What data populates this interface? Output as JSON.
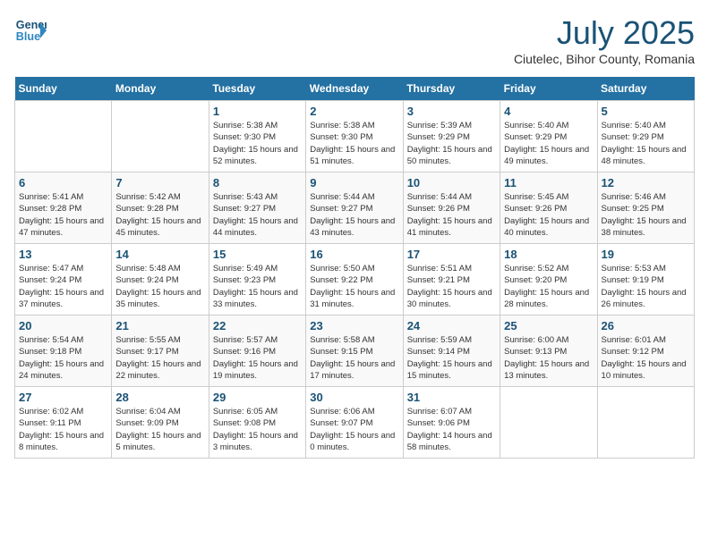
{
  "header": {
    "logo_line1": "General",
    "logo_line2": "Blue",
    "month": "July 2025",
    "location": "Ciutelec, Bihor County, Romania"
  },
  "weekdays": [
    "Sunday",
    "Monday",
    "Tuesday",
    "Wednesday",
    "Thursday",
    "Friday",
    "Saturday"
  ],
  "weeks": [
    [
      {
        "day": "",
        "sunrise": "",
        "sunset": "",
        "daylight": ""
      },
      {
        "day": "",
        "sunrise": "",
        "sunset": "",
        "daylight": ""
      },
      {
        "day": "1",
        "sunrise": "Sunrise: 5:38 AM",
        "sunset": "Sunset: 9:30 PM",
        "daylight": "Daylight: 15 hours and 52 minutes."
      },
      {
        "day": "2",
        "sunrise": "Sunrise: 5:38 AM",
        "sunset": "Sunset: 9:30 PM",
        "daylight": "Daylight: 15 hours and 51 minutes."
      },
      {
        "day": "3",
        "sunrise": "Sunrise: 5:39 AM",
        "sunset": "Sunset: 9:29 PM",
        "daylight": "Daylight: 15 hours and 50 minutes."
      },
      {
        "day": "4",
        "sunrise": "Sunrise: 5:40 AM",
        "sunset": "Sunset: 9:29 PM",
        "daylight": "Daylight: 15 hours and 49 minutes."
      },
      {
        "day": "5",
        "sunrise": "Sunrise: 5:40 AM",
        "sunset": "Sunset: 9:29 PM",
        "daylight": "Daylight: 15 hours and 48 minutes."
      }
    ],
    [
      {
        "day": "6",
        "sunrise": "Sunrise: 5:41 AM",
        "sunset": "Sunset: 9:28 PM",
        "daylight": "Daylight: 15 hours and 47 minutes."
      },
      {
        "day": "7",
        "sunrise": "Sunrise: 5:42 AM",
        "sunset": "Sunset: 9:28 PM",
        "daylight": "Daylight: 15 hours and 45 minutes."
      },
      {
        "day": "8",
        "sunrise": "Sunrise: 5:43 AM",
        "sunset": "Sunset: 9:27 PM",
        "daylight": "Daylight: 15 hours and 44 minutes."
      },
      {
        "day": "9",
        "sunrise": "Sunrise: 5:44 AM",
        "sunset": "Sunset: 9:27 PM",
        "daylight": "Daylight: 15 hours and 43 minutes."
      },
      {
        "day": "10",
        "sunrise": "Sunrise: 5:44 AM",
        "sunset": "Sunset: 9:26 PM",
        "daylight": "Daylight: 15 hours and 41 minutes."
      },
      {
        "day": "11",
        "sunrise": "Sunrise: 5:45 AM",
        "sunset": "Sunset: 9:26 PM",
        "daylight": "Daylight: 15 hours and 40 minutes."
      },
      {
        "day": "12",
        "sunrise": "Sunrise: 5:46 AM",
        "sunset": "Sunset: 9:25 PM",
        "daylight": "Daylight: 15 hours and 38 minutes."
      }
    ],
    [
      {
        "day": "13",
        "sunrise": "Sunrise: 5:47 AM",
        "sunset": "Sunset: 9:24 PM",
        "daylight": "Daylight: 15 hours and 37 minutes."
      },
      {
        "day": "14",
        "sunrise": "Sunrise: 5:48 AM",
        "sunset": "Sunset: 9:24 PM",
        "daylight": "Daylight: 15 hours and 35 minutes."
      },
      {
        "day": "15",
        "sunrise": "Sunrise: 5:49 AM",
        "sunset": "Sunset: 9:23 PM",
        "daylight": "Daylight: 15 hours and 33 minutes."
      },
      {
        "day": "16",
        "sunrise": "Sunrise: 5:50 AM",
        "sunset": "Sunset: 9:22 PM",
        "daylight": "Daylight: 15 hours and 31 minutes."
      },
      {
        "day": "17",
        "sunrise": "Sunrise: 5:51 AM",
        "sunset": "Sunset: 9:21 PM",
        "daylight": "Daylight: 15 hours and 30 minutes."
      },
      {
        "day": "18",
        "sunrise": "Sunrise: 5:52 AM",
        "sunset": "Sunset: 9:20 PM",
        "daylight": "Daylight: 15 hours and 28 minutes."
      },
      {
        "day": "19",
        "sunrise": "Sunrise: 5:53 AM",
        "sunset": "Sunset: 9:19 PM",
        "daylight": "Daylight: 15 hours and 26 minutes."
      }
    ],
    [
      {
        "day": "20",
        "sunrise": "Sunrise: 5:54 AM",
        "sunset": "Sunset: 9:18 PM",
        "daylight": "Daylight: 15 hours and 24 minutes."
      },
      {
        "day": "21",
        "sunrise": "Sunrise: 5:55 AM",
        "sunset": "Sunset: 9:17 PM",
        "daylight": "Daylight: 15 hours and 22 minutes."
      },
      {
        "day": "22",
        "sunrise": "Sunrise: 5:57 AM",
        "sunset": "Sunset: 9:16 PM",
        "daylight": "Daylight: 15 hours and 19 minutes."
      },
      {
        "day": "23",
        "sunrise": "Sunrise: 5:58 AM",
        "sunset": "Sunset: 9:15 PM",
        "daylight": "Daylight: 15 hours and 17 minutes."
      },
      {
        "day": "24",
        "sunrise": "Sunrise: 5:59 AM",
        "sunset": "Sunset: 9:14 PM",
        "daylight": "Daylight: 15 hours and 15 minutes."
      },
      {
        "day": "25",
        "sunrise": "Sunrise: 6:00 AM",
        "sunset": "Sunset: 9:13 PM",
        "daylight": "Daylight: 15 hours and 13 minutes."
      },
      {
        "day": "26",
        "sunrise": "Sunrise: 6:01 AM",
        "sunset": "Sunset: 9:12 PM",
        "daylight": "Daylight: 15 hours and 10 minutes."
      }
    ],
    [
      {
        "day": "27",
        "sunrise": "Sunrise: 6:02 AM",
        "sunset": "Sunset: 9:11 PM",
        "daylight": "Daylight: 15 hours and 8 minutes."
      },
      {
        "day": "28",
        "sunrise": "Sunrise: 6:04 AM",
        "sunset": "Sunset: 9:09 PM",
        "daylight": "Daylight: 15 hours and 5 minutes."
      },
      {
        "day": "29",
        "sunrise": "Sunrise: 6:05 AM",
        "sunset": "Sunset: 9:08 PM",
        "daylight": "Daylight: 15 hours and 3 minutes."
      },
      {
        "day": "30",
        "sunrise": "Sunrise: 6:06 AM",
        "sunset": "Sunset: 9:07 PM",
        "daylight": "Daylight: 15 hours and 0 minutes."
      },
      {
        "day": "31",
        "sunrise": "Sunrise: 6:07 AM",
        "sunset": "Sunset: 9:06 PM",
        "daylight": "Daylight: 14 hours and 58 minutes."
      },
      {
        "day": "",
        "sunrise": "",
        "sunset": "",
        "daylight": ""
      },
      {
        "day": "",
        "sunrise": "",
        "sunset": "",
        "daylight": ""
      }
    ]
  ]
}
